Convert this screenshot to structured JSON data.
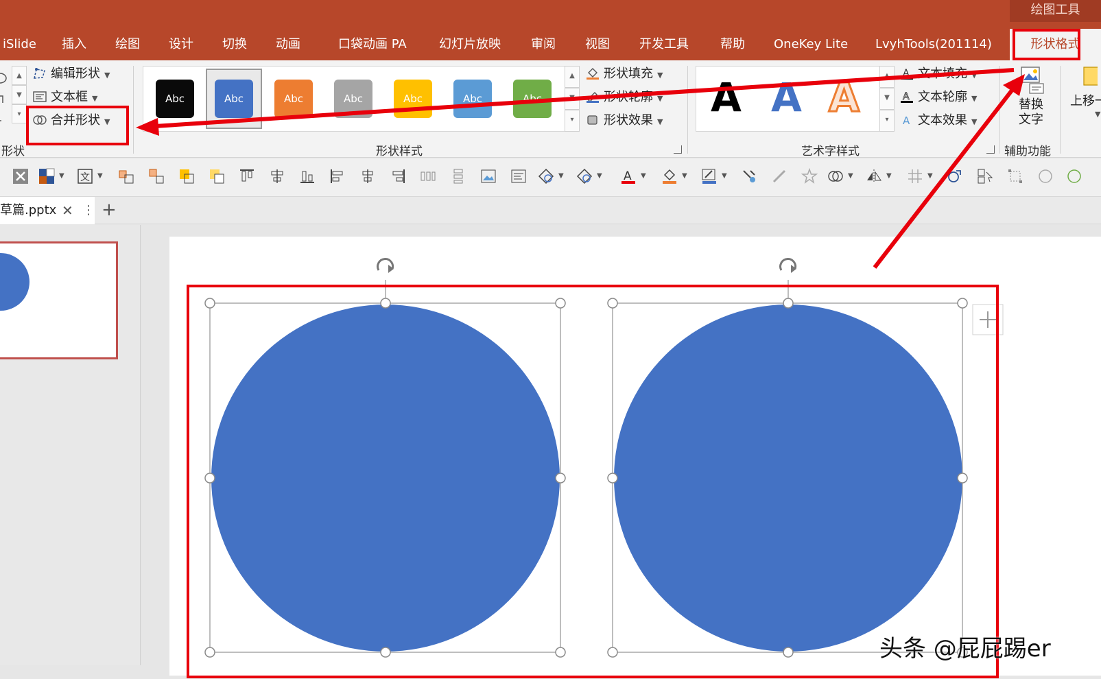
{
  "tabs": {
    "context_group": "绘图工具",
    "items": [
      "iSlide",
      "插入",
      "绘图",
      "设计",
      "切换",
      "动画",
      "口袋动画 PA",
      "幻灯片放映",
      "审阅",
      "视图",
      "开发工具",
      "帮助",
      "OneKey Lite",
      "LvyhTools(201114)"
    ],
    "active": "形状格式"
  },
  "ribbon": {
    "insert_shapes": {
      "edit_shape": "编辑形状",
      "text_box": "文本框",
      "merge_shapes": "合并形状",
      "group_label": "形状"
    },
    "shape_styles": {
      "swatches": [
        {
          "label": "Abc",
          "color": "#0a0a0a"
        },
        {
          "label": "Abc",
          "color": "#4472c4"
        },
        {
          "label": "Abc",
          "color": "#ed7d31"
        },
        {
          "label": "Abc",
          "color": "#a5a5a5"
        },
        {
          "label": "Abc",
          "color": "#ffc000"
        },
        {
          "label": "Abc",
          "color": "#5b9bd5"
        },
        {
          "label": "Abc",
          "color": "#70ad47"
        }
      ],
      "shape_fill": "形状填充",
      "shape_outline": "形状轮廓",
      "shape_effects": "形状效果",
      "group_label": "形状样式"
    },
    "wordart_styles": {
      "samples": [
        "A",
        "A",
        "A"
      ],
      "text_fill": "文本填充",
      "text_outline": "文本轮廓",
      "text_effects": "文本效果",
      "group_label": "艺术字样式"
    },
    "accessibility": {
      "alt_text": "替换\n文字",
      "group_label": "辅助功能"
    },
    "arrange": {
      "bring_forward": "上移一"
    }
  },
  "document": {
    "tab_name": "草篇.pptx"
  },
  "colors": {
    "accent": "#b7472a",
    "shape_blue": "#4472c4",
    "annotation_red": "#e8000b"
  },
  "watermark": "头条 @屁屁踢er"
}
